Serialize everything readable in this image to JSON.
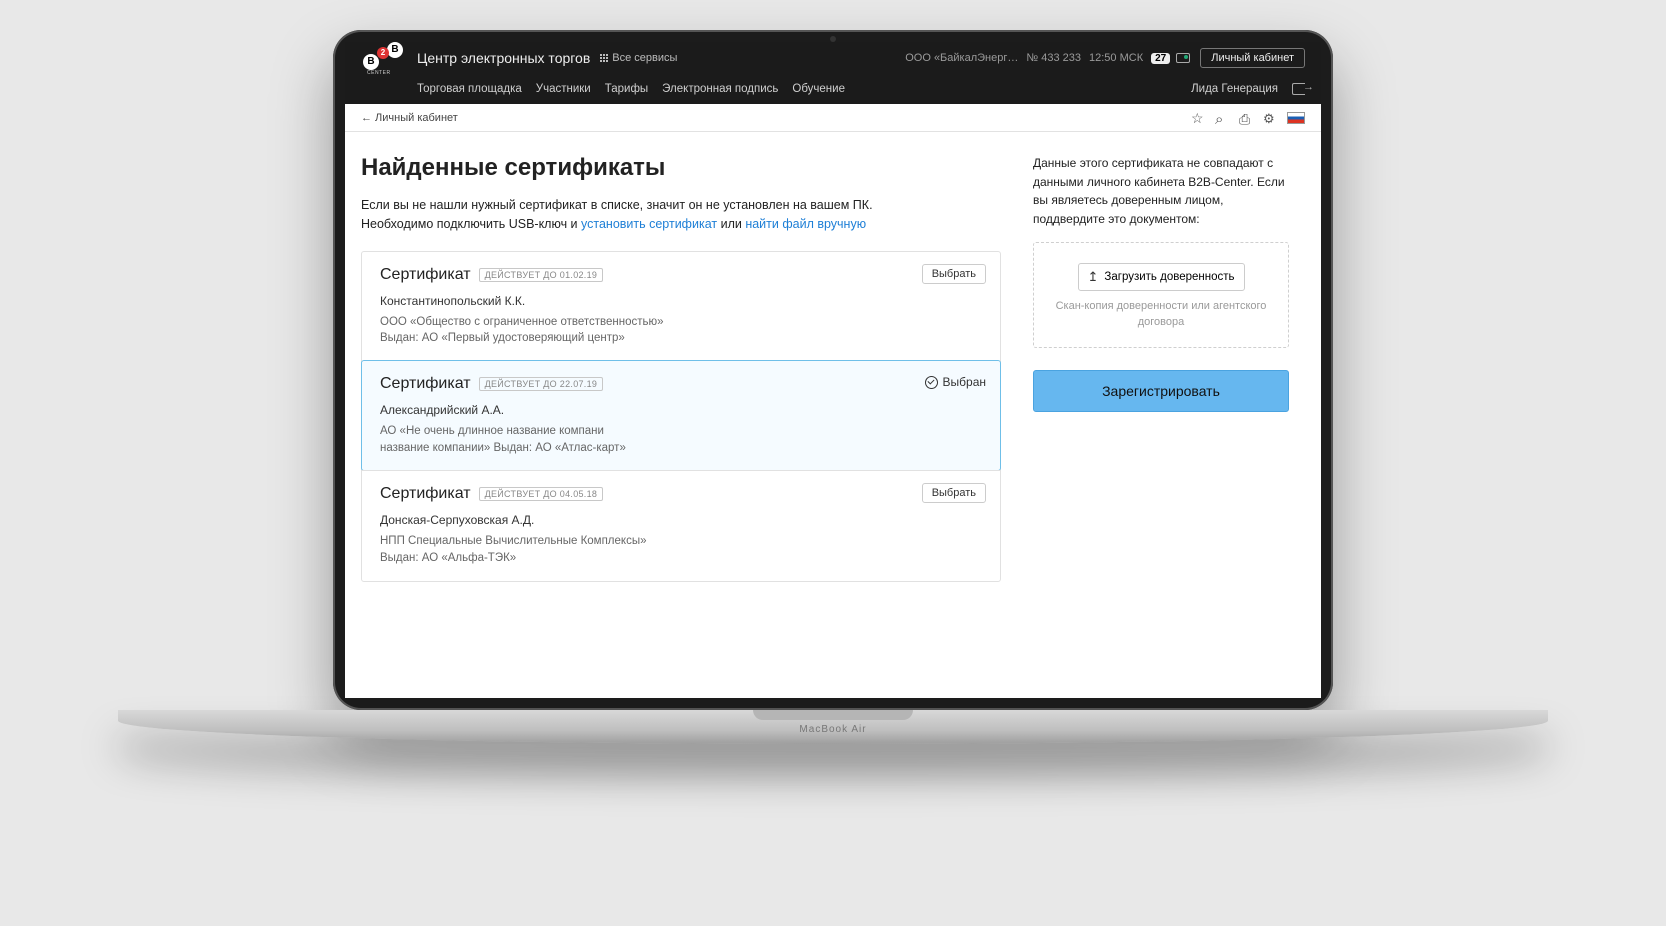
{
  "header": {
    "brand": "Центр электронных торгов",
    "all_services": "Все сервисы",
    "company": "ООО «БайкалЭнерг…",
    "account_no": "№ 433 233",
    "time": "12:50 МСК",
    "badge_count": "27",
    "cabinet_btn": "Личный кабинет",
    "nav": {
      "a": "Торговая площадка",
      "b": "Участники",
      "c": "Тарифы",
      "d": "Электронная подпись",
      "e": "Обучение"
    },
    "user": "Лида Генерация"
  },
  "breadcrumb": "← Личный кабинет",
  "page": {
    "title": "Найденные сертификаты",
    "lead1": "Если вы не нашли нужный сертификат в списке, значит он не установлен на вашем ПК.",
    "lead2a": "Необходимо подключить USB-ключ и ",
    "lead2_link1": "установить сертификат",
    "lead2b": " или ",
    "lead2_link2": "найти файл вручную"
  },
  "certs": [
    {
      "title": "Сертификат",
      "badge": "ДЕЙСТВУЕТ ДО 01.02.19",
      "name": "Константинопольский К.К.",
      "org": "ООО «Общество с ограниченное ответственностью»",
      "issuer": "Выдан: АО «Первый удостоверяющий центр»",
      "action": "Выбрать",
      "selected": false
    },
    {
      "title": "Сертификат",
      "badge": "ДЕЙСТВУЕТ ДО 22.07.19",
      "name": "Александрийский А.А.",
      "org": "АО «Не очень длинное название компани",
      "issuer": "название компании» Выдан:  АО «Атлас-карт»",
      "action": "Выбран",
      "selected": true
    },
    {
      "title": "Сертификат",
      "badge": "ДЕЙСТВУЕТ ДО 04.05.18",
      "name": "Донская-Серпуховская А.Д.",
      "org": "НПП Специальные Вычислительные Комплексы»",
      "issuer": "Выдан:  АО «Альфа-ТЭК»",
      "action": "Выбрать",
      "selected": false
    }
  ],
  "side": {
    "notice": "Данные этого сертификата не совпадают с данными личного кабинета B2B-Center. Если вы являетесь доверенным лицом, поддвердите это документом:",
    "upload_btn": "Загрузить доверенность",
    "upload_hint": "Скан-копия доверенности или агентского договора",
    "register_btn": "Зарегистрировать"
  },
  "device_label": "MacBook Air"
}
